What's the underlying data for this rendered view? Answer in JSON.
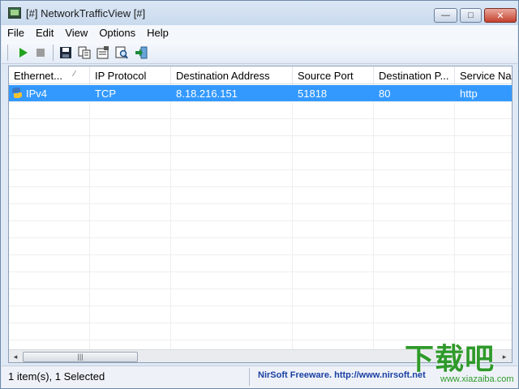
{
  "window": {
    "title": "[#] NetworkTrafficView [#]",
    "controls": {
      "minimize": "—",
      "maximize": "□",
      "close": "✕"
    }
  },
  "menu": [
    "File",
    "Edit",
    "View",
    "Options",
    "Help"
  ],
  "toolbar": {
    "icons": [
      "play-icon",
      "stop-icon",
      "save-icon",
      "copy-icon",
      "properties-icon",
      "find-icon",
      "exit-icon"
    ]
  },
  "columns": [
    "Ethernet...",
    "IP Protocol",
    "Destination Address",
    "Source Port",
    "Destination P...",
    "Service Nar"
  ],
  "rows": [
    {
      "ethernet": "IPv4",
      "protocol": "TCP",
      "dest_address": "8.18.216.151",
      "source_port": "51818",
      "dest_port": "80",
      "service": "http"
    }
  ],
  "scrollbar": {
    "left_arrow": "◂",
    "right_arrow": "▸",
    "grip": "|||"
  },
  "status": {
    "count": "1 item(s), 1 Selected",
    "credit": "NirSoft Freeware.  http://www.nirsoft.net"
  },
  "watermark": {
    "logo": "下载吧",
    "url": "www.xiazaiba.com"
  },
  "colors": {
    "selection": "#3399ff",
    "play": "#1fa31f",
    "watermark": "#2f9a2a"
  }
}
